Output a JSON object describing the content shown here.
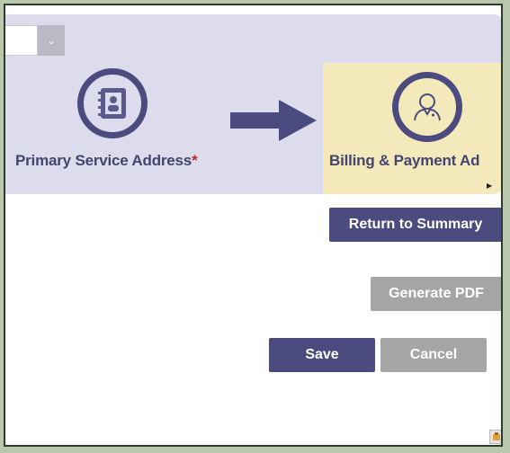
{
  "stepper": {
    "dropdown_value": "",
    "steps": [
      {
        "label": "Primary Service Address",
        "required_mark": "*",
        "icon": "address-book-icon"
      },
      {
        "label": "Billing & Payment Ad",
        "icon": "user-icon",
        "active": true
      }
    ]
  },
  "actions": {
    "return_to_summary": "Return to Summary",
    "generate_pdf": "Generate PDF",
    "save": "Save",
    "cancel": "Cancel"
  },
  "colors": {
    "primary": "#4b4b7f",
    "disabled": "#a5a5a5",
    "stepper_bg": "#dcdcec",
    "active_step_bg": "#f4e9bb",
    "required": "#c62828"
  }
}
